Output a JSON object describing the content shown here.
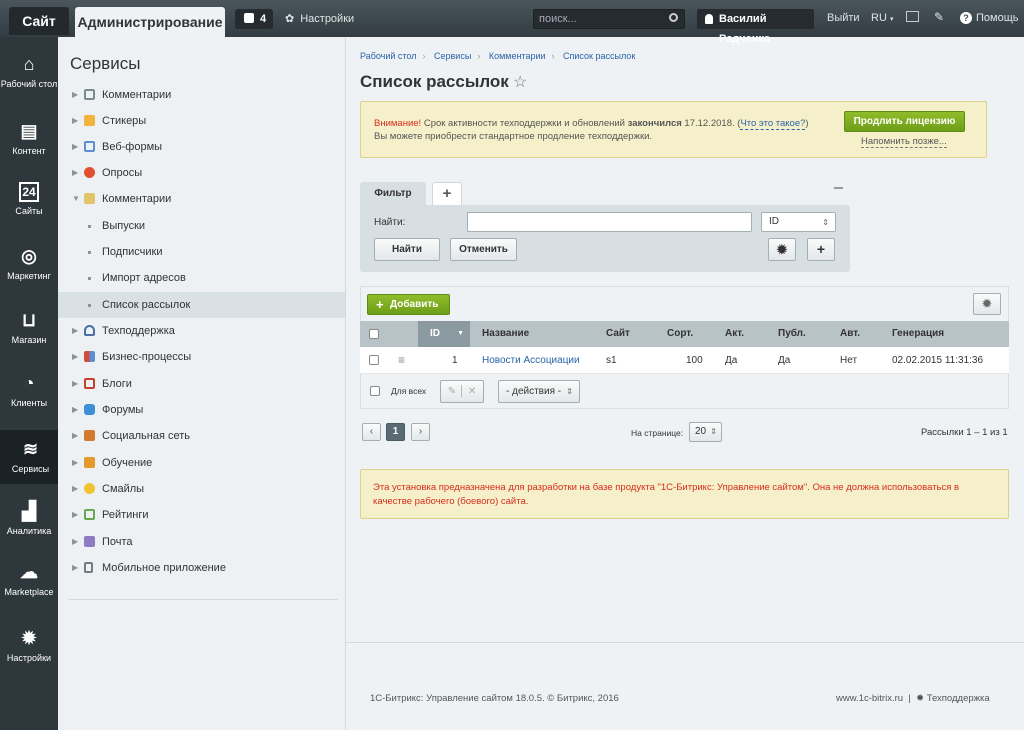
{
  "topbar": {
    "site_tab": "Сайт",
    "admin_tab": "Администрирование",
    "notifications_count": "4",
    "settings": "Настройки",
    "search_placeholder": "поиск...",
    "user_name": "Василий Радченко",
    "logout": "Выйти",
    "lang": "RU",
    "help": "Помощь"
  },
  "iconbar": [
    {
      "label": "Рабочий стол",
      "icon": "home-icon"
    },
    {
      "label": "Контент",
      "icon": "document-icon"
    },
    {
      "label": "Сайты",
      "icon": "calendar-icon"
    },
    {
      "label": "Маркетинг",
      "icon": "target-icon"
    },
    {
      "label": "Магазин",
      "icon": "basket-icon"
    },
    {
      "label": "Клиенты",
      "icon": "clock-icon"
    },
    {
      "label": "Сервисы",
      "icon": "layers-icon"
    },
    {
      "label": "Аналитика",
      "icon": "bar-chart-icon"
    },
    {
      "label": "Marketplace",
      "icon": "cloud-download-icon"
    },
    {
      "label": "Настройки",
      "icon": "gear-icon"
    }
  ],
  "sidebar": {
    "title": "Сервисы",
    "items": [
      {
        "label": "Комментарии",
        "color": "#7a8a93"
      },
      {
        "label": "Стикеры",
        "color": "#f0b33c"
      },
      {
        "label": "Веб-формы",
        "color": "#5b8fd1"
      },
      {
        "label": "Опросы",
        "color": "#e0512f"
      },
      {
        "label": "Комментарии",
        "color": "#e2c46a"
      },
      {
        "label": "Выпуски"
      },
      {
        "label": "Подписчики"
      },
      {
        "label": "Импорт адресов"
      },
      {
        "label": "Список рассылок"
      },
      {
        "label": "Техподдержка",
        "color": "#4a6ea8"
      },
      {
        "label": "Бизнес-процессы",
        "color": "#d24a3b"
      },
      {
        "label": "Блоги",
        "color": "#c7402f"
      },
      {
        "label": "Форумы",
        "color": "#3f8fd6"
      },
      {
        "label": "Социальная сеть",
        "color": "#d47a30"
      },
      {
        "label": "Обучение",
        "color": "#e39a2a"
      },
      {
        "label": "Смайлы",
        "color": "#f1c232"
      },
      {
        "label": "Рейтинги",
        "color": "#6aa84f"
      },
      {
        "label": "Почта",
        "color": "#8e7cc3"
      },
      {
        "label": "Мобильное приложение",
        "color": "#6d7d86"
      }
    ]
  },
  "main": {
    "breadcrumbs": [
      "Рабочий стол",
      "Сервисы",
      "Комментарии",
      "Список рассылок"
    ],
    "title": "Список рассылок",
    "warning": {
      "prefix": "Внимание!",
      "text1": " Срок активности техподдержки и обновлений ",
      "bold": "закончился",
      "text2": " 17.12.2018. (",
      "link": "Что это такое?",
      "text3": ")",
      "line2": "Вы можете приобрести стандартное продление техподдержки.",
      "button": "Продлить лицензию",
      "remind": "Напомнить позже..."
    },
    "filter": {
      "tab": "Фильтр",
      "find_label": "Найти:",
      "field_select": "ID",
      "find_button": "Найти",
      "cancel_button": "Отменить"
    },
    "grid": {
      "add_button": "Добавить",
      "columns": [
        "ID",
        "Название",
        "Сайт",
        "Сорт.",
        "Акт.",
        "Публ.",
        "Авт.",
        "Генерация"
      ],
      "rows": [
        {
          "id": "1",
          "name": "Новости Ассоциации",
          "site": "s1",
          "sort": "100",
          "active": "Да",
          "public": "Да",
          "auto": "Нет",
          "generation": "02.02.2015 11:31:36"
        }
      ],
      "for_all": "Для всех",
      "actions_select": "- действия -"
    },
    "pager": {
      "current": "1",
      "per_page_label": "На странице:",
      "per_page": "20",
      "count": "Рассылки 1 – 1 из 1"
    },
    "notice": "Эта установка предназначена для разработки на базе продукта \"1С-Битрикс: Управление сайтом\". Она не должна использоваться в качестве рабочего (боевого) сайта."
  },
  "footer": {
    "copyright": "1С-Битрикс: Управление сайтом 18.0.5. © Битрикс, 2016",
    "site": "www.1c-bitrix.ru",
    "support": "Техподдержка"
  }
}
